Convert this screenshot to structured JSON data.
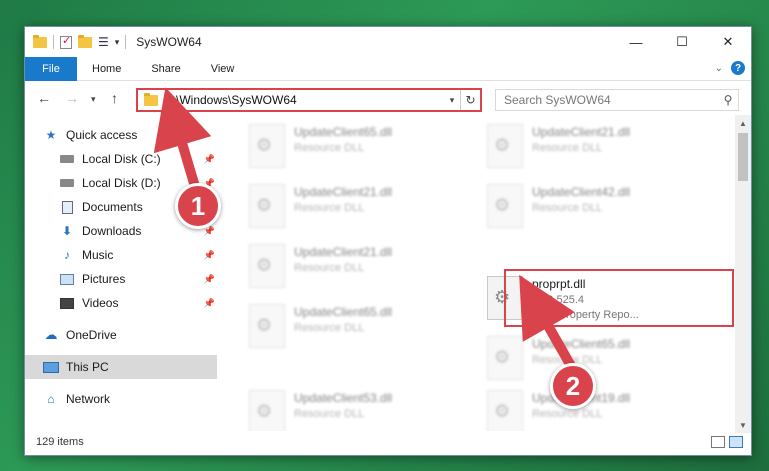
{
  "window": {
    "title": "SysWOW64"
  },
  "ribbon": {
    "tabs": [
      "File",
      "Home",
      "Share",
      "View"
    ]
  },
  "address": {
    "path": "C:\\Windows\\SysWOW64"
  },
  "search": {
    "placeholder": "Search SysWOW64"
  },
  "sidebar": {
    "items": [
      {
        "label": "Quick access",
        "icon": "star-icon",
        "pinned": false
      },
      {
        "label": "Local Disk (C:)",
        "icon": "drive-icon",
        "pinned": true
      },
      {
        "label": "Local Disk (D:)",
        "icon": "drive-icon",
        "pinned": true
      },
      {
        "label": "Documents",
        "icon": "document-icon",
        "pinned": true
      },
      {
        "label": "Downloads",
        "icon": "download-icon",
        "pinned": true
      },
      {
        "label": "Music",
        "icon": "music-icon",
        "pinned": true
      },
      {
        "label": "Pictures",
        "icon": "picture-icon",
        "pinned": true
      },
      {
        "label": "Videos",
        "icon": "video-icon",
        "pinned": true
      },
      {
        "label": "OneDrive",
        "icon": "cloud-icon",
        "pinned": false
      },
      {
        "label": "This PC",
        "icon": "computer-icon",
        "pinned": false,
        "selected": true
      },
      {
        "label": "Network",
        "icon": "network-icon",
        "pinned": false
      }
    ]
  },
  "files": [
    {
      "name": "UpdateClient65.dll",
      "sub": "Resource DLL",
      "blurred": true
    },
    {
      "name": "UpdateClient21.dll",
      "sub": "Resource DLL",
      "blurred": true
    },
    {
      "name": "UpdateClient21.dll",
      "sub": "Resource DLL",
      "blurred": true
    },
    {
      "name": "UpdateClient42.dll",
      "sub": "Resource DLL",
      "blurred": true
    },
    {
      "name": "UpdateClient21.dll",
      "sub": "Resource DLL",
      "blurred": true
    },
    {
      "name": "proprpt.dll",
      "sub": "10.0.525.4",
      "sub2": "Visio Property Repo...",
      "blurred": false
    },
    {
      "name": "UpdateClient65.dll",
      "sub": "Resource DLL",
      "blurred": true
    },
    {
      "name": "UpdateClient65.dll",
      "sub": "Resource DLL",
      "blurred": true
    },
    {
      "name": "UpdateClient53.dll",
      "sub": "Resource DLL",
      "blurred": true
    },
    {
      "name": "UpdateClient19.dll",
      "sub": "Resource DLL",
      "blurred": true
    }
  ],
  "status": {
    "count": "129 items"
  },
  "annotations": {
    "marker1": "1",
    "marker2": "2",
    "color": "#d9434b"
  }
}
